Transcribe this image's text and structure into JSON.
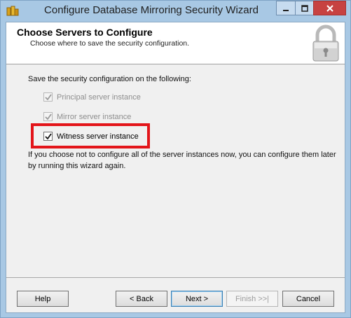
{
  "window": {
    "title": "Configure Database Mirroring Security Wizard"
  },
  "header": {
    "heading": "Choose Servers to Configure",
    "subheading": "Choose where to save the security configuration.",
    "icon": "padlock-icon"
  },
  "content": {
    "intro": "Save the security configuration on the following:",
    "checkboxes": [
      {
        "label": "Principal server instance",
        "checked": true,
        "enabled": false
      },
      {
        "label": "Mirror server instance",
        "checked": true,
        "enabled": false
      },
      {
        "label": "Witness server instance",
        "checked": true,
        "enabled": true
      }
    ],
    "note": "If you choose not to configure all of the server instances now, you can configure them later by running this wizard again."
  },
  "buttons": {
    "help": "Help",
    "back": "< Back",
    "next": "Next >",
    "finish": "Finish >>|",
    "cancel": "Cancel"
  },
  "colors": {
    "highlight": "#e3151a",
    "close_button": "#c74241"
  }
}
